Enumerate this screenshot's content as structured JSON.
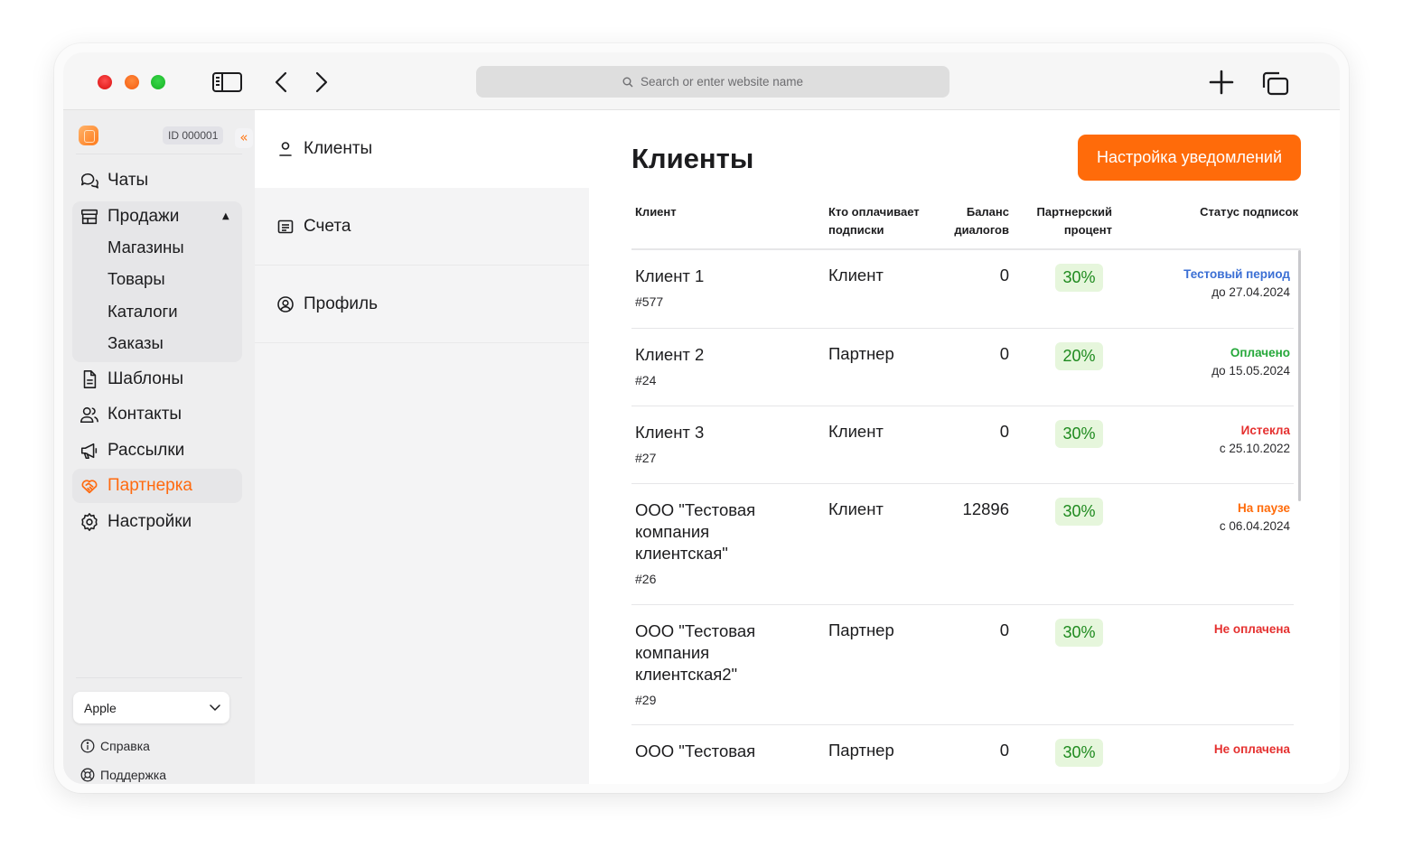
{
  "browser": {
    "address_placeholder": "Search or enter website name"
  },
  "sidebar": {
    "id_badge": "ID 000001",
    "collapse_glyph": "«",
    "items": [
      {
        "label": "Чаты",
        "icon": "chat-icon"
      },
      {
        "label": "Продажи",
        "icon": "store-icon",
        "expanded": true,
        "children": [
          "Магазины",
          "Товары",
          "Каталоги",
          "Заказы"
        ]
      },
      {
        "label": "Шаблоны",
        "icon": "document-icon"
      },
      {
        "label": "Контакты",
        "icon": "users-icon"
      },
      {
        "label": "Рассылки",
        "icon": "megaphone-icon"
      },
      {
        "label": "Партнерка",
        "icon": "handshake-icon",
        "active": true
      },
      {
        "label": "Настройки",
        "icon": "gear-icon"
      }
    ],
    "store_select": "Apple",
    "footer": {
      "help": "Справка",
      "support": "Поддержка"
    }
  },
  "subnav": {
    "items": [
      {
        "label": "Клиенты",
        "icon": "person-icon",
        "active": true
      },
      {
        "label": "Счета",
        "icon": "invoice-icon"
      },
      {
        "label": "Профиль",
        "icon": "at-icon"
      }
    ]
  },
  "main": {
    "title": "Клиенты",
    "notify_button": "Настройка уведомлений",
    "columns": {
      "client": "Клиент",
      "payer_line1": "Кто оплачивает",
      "payer_line2": "подписки",
      "balance_line1": "Баланс",
      "balance_line2": "диалогов",
      "percent_line1": "Партнерский",
      "percent_line2": "процент",
      "status": "Статус подписок"
    },
    "rows": [
      {
        "name": "Клиент 1",
        "id": "#577",
        "payer": "Клиент",
        "balance": "0",
        "percent": "30%",
        "status": "Тестовый период",
        "status_date": "до 27.04.2024"
      },
      {
        "name": "Клиент 2",
        "id": "#24",
        "payer": "Партнер",
        "balance": "0",
        "percent": "20%",
        "status": "Оплачено",
        "status_date": "до 15.05.2024"
      },
      {
        "name": "Клиент 3",
        "id": "#27",
        "payer": "Клиент",
        "balance": "0",
        "percent": "30%",
        "status": "Истекла",
        "status_date": "с 25.10.2022"
      },
      {
        "name": "ООО \"Тестовая компания клиентская\"",
        "id": "#26",
        "payer": "Клиент",
        "balance": "12896",
        "percent": "30%",
        "status": "На паузе",
        "status_date": "с 06.04.2024"
      },
      {
        "name": "ООО \"Тестовая компания клиентская2\"",
        "id": "#29",
        "payer": "Партнер",
        "balance": "0",
        "percent": "30%",
        "status": "Не оплачена",
        "status_date": ""
      },
      {
        "name": "ООО \"Тестовая",
        "id": "",
        "payer": "Партнер",
        "balance": "0",
        "percent": "30%",
        "status": "Не оплачена",
        "status_date": ""
      }
    ]
  },
  "colors": {
    "accent": "#ff6b0a",
    "status_trial": "#3b6fd4",
    "status_paid": "#25a83a",
    "status_expired": "#e5302f",
    "status_paused": "#ff6b0a",
    "status_unpaid": "#e5302f",
    "percent_bg": "#e6f6dc",
    "percent_text": "#1e8a1e"
  }
}
